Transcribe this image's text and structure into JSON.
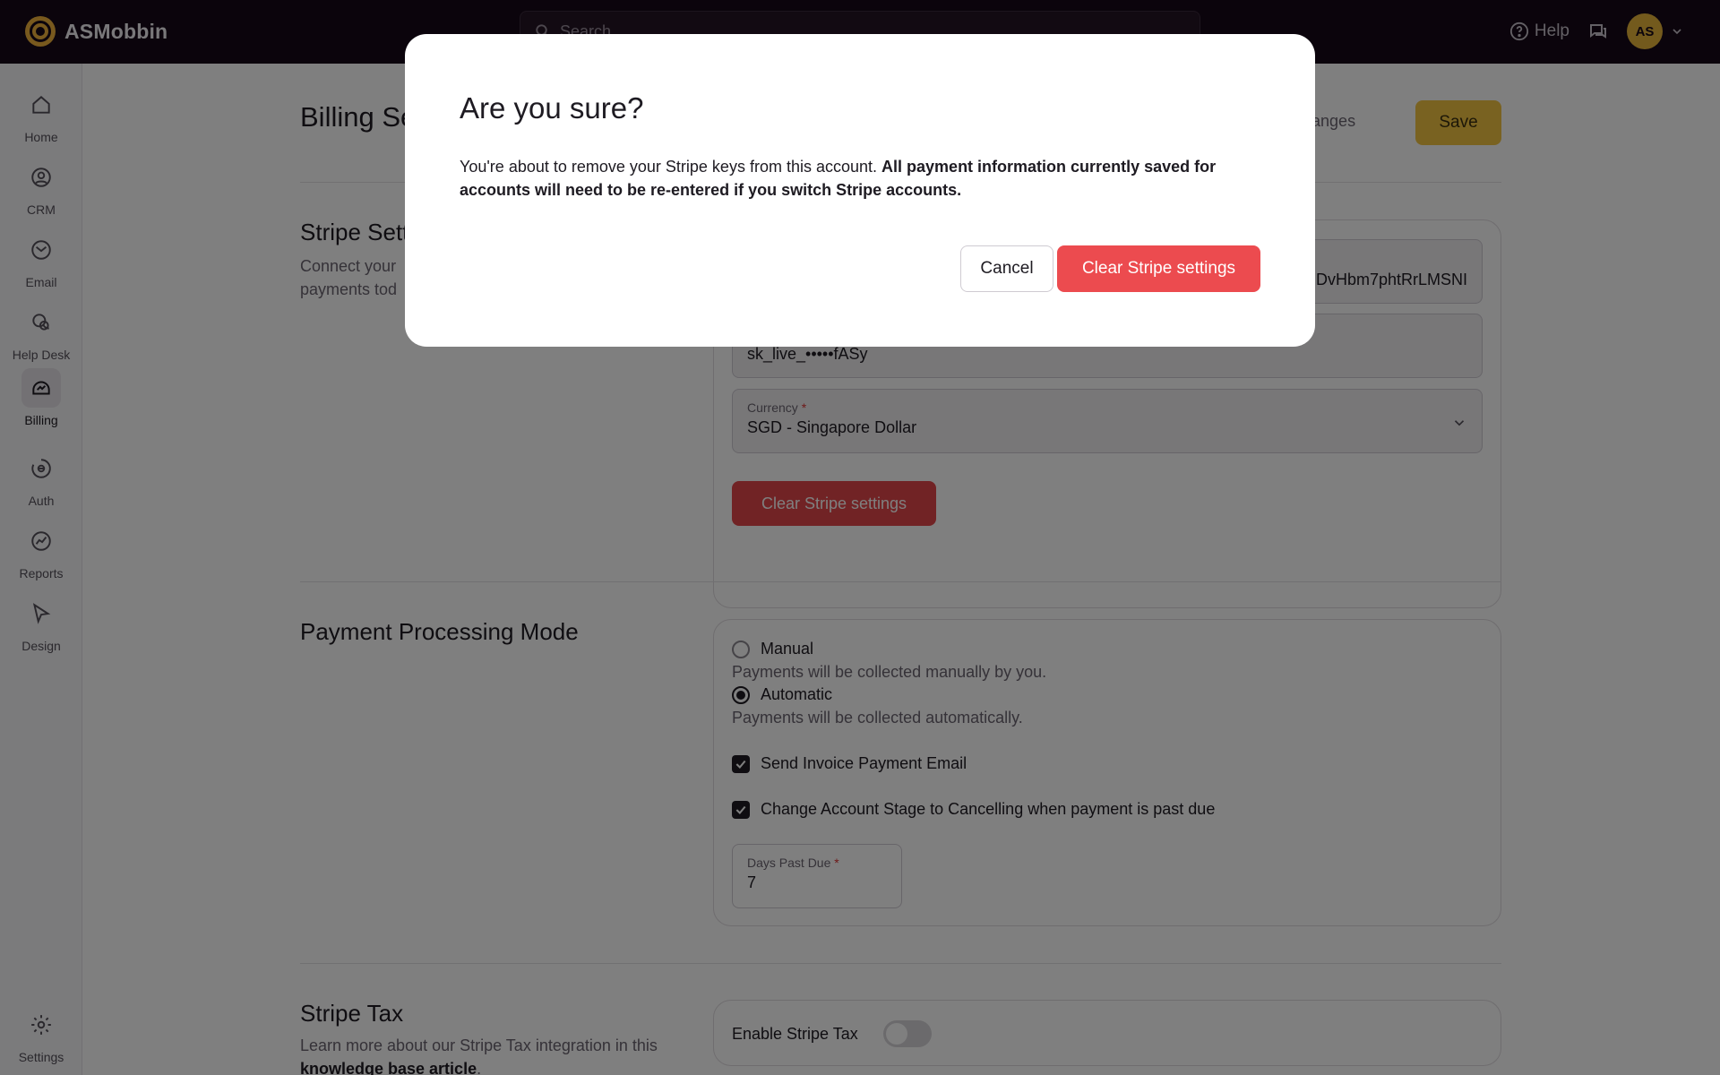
{
  "app": {
    "name": "ASMobbin"
  },
  "search": {
    "placeholder": "Search"
  },
  "header": {
    "help_label": "Help",
    "avatar_initials": "AS"
  },
  "sidebar": {
    "items": [
      {
        "label": "Home",
        "icon": "home-icon"
      },
      {
        "label": "CRM",
        "icon": "crm-icon"
      },
      {
        "label": "Email",
        "icon": "email-icon"
      },
      {
        "label": "Help Desk",
        "icon": "help-desk-icon"
      },
      {
        "label": "Billing",
        "icon": "billing-icon",
        "active": true
      },
      {
        "label": "Auth",
        "icon": "auth-icon"
      },
      {
        "label": "Reports",
        "icon": "reports-icon"
      },
      {
        "label": "Design",
        "icon": "design-icon"
      }
    ],
    "settings_label": "Settings"
  },
  "page": {
    "title": "Billing Se",
    "unsaved_label": "d changes",
    "save_label": "Save"
  },
  "stripe_settings": {
    "title": "Stripe Sett",
    "desc_line1": "Connect your",
    "desc_line2": "payments tod",
    "publishable_key": "DvHbm7phtRrLMSNI",
    "secret_key": "sk_live_•••••fASy",
    "currency_label": "Currency",
    "currency_value": "SGD - Singapore Dollar",
    "clear_button": "Clear Stripe settings"
  },
  "payment_mode": {
    "title": "Payment Processing Mode",
    "manual_label": "Manual",
    "manual_help": "Payments will be collected manually by you.",
    "automatic_label": "Automatic",
    "automatic_help": "Payments will be collected automatically.",
    "selected": "Automatic",
    "send_invoice_label": "Send Invoice Payment Email",
    "send_invoice_checked": true,
    "change_stage_label": "Change Account Stage to Cancelling when payment is past due",
    "change_stage_checked": true,
    "days_past_due_label": "Days Past Due",
    "days_past_due_value": "7"
  },
  "stripe_tax": {
    "title": "Stripe Tax",
    "desc_prefix": "Learn more about our Stripe Tax integration in this",
    "desc_link": "knowledge base article",
    "desc_suffix": ".",
    "enable_label": "Enable Stripe Tax",
    "enabled": false
  },
  "modal": {
    "title": "Are you sure?",
    "body_normal": "You're about to remove your Stripe keys from this account.",
    "body_strong": "All payment information currently saved for accounts will need to be re-entered if you switch Stripe accounts.",
    "cancel_label": "Cancel",
    "confirm_label": "Clear Stripe settings"
  },
  "colors": {
    "topbar": "#170818",
    "accent": "#f2c443",
    "danger": "#ec4b4f"
  }
}
